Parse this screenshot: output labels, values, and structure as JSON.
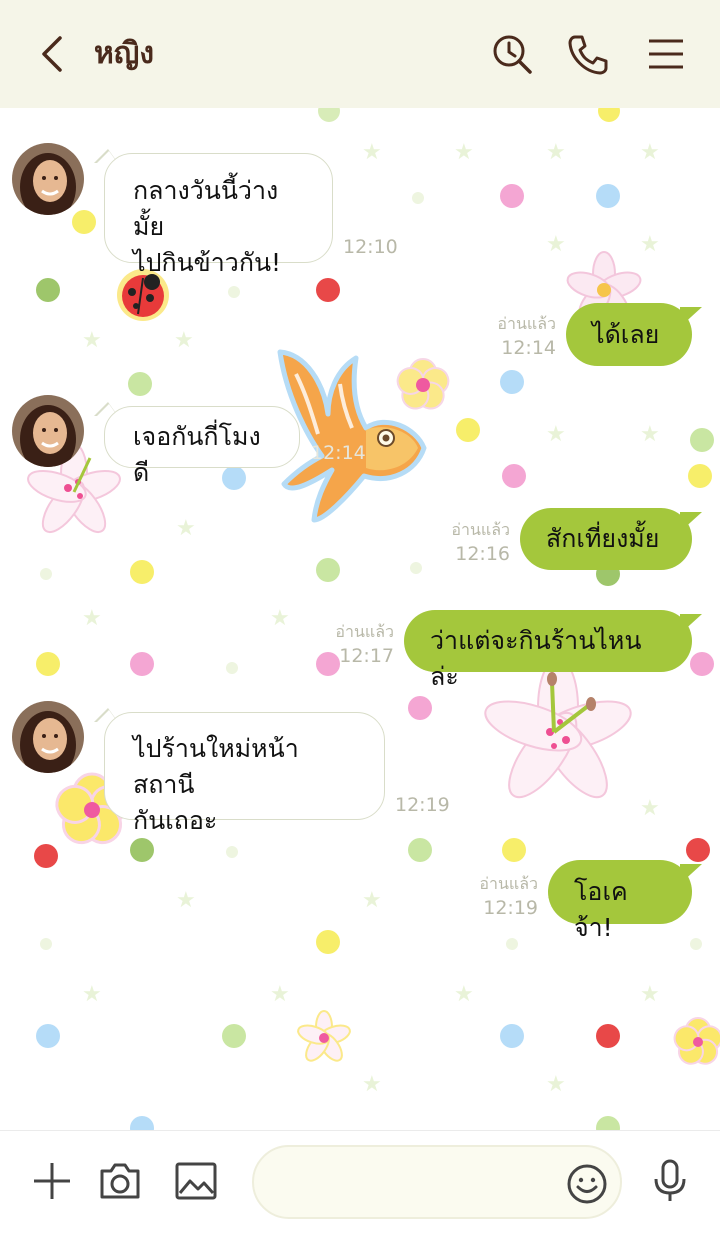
{
  "header": {
    "title": "หญิง",
    "background": "#f5f5e8",
    "text_color": "#4a2a1c"
  },
  "messages": [
    {
      "side": "in",
      "text_lines": [
        "กลางวันนี้ว่างมั้ย",
        "ไปกินข้าวกัน!"
      ],
      "time": "12:10"
    },
    {
      "side": "out",
      "text": "ได้เลย",
      "read": "อ่านแล้ว",
      "time": "12:14"
    },
    {
      "side": "in",
      "text": "เจอกันกี่โมงดี",
      "time": "12:14"
    },
    {
      "side": "out",
      "text": "สักเที่ยงมั้ย",
      "read": "อ่านแล้ว",
      "time": "12:16"
    },
    {
      "side": "out",
      "text": "ว่าแต่จะกินร้านไหนล่ะ",
      "read": "อ่านแล้ว",
      "time": "12:17"
    },
    {
      "side": "in",
      "text_lines": [
        "ไปร้านใหม่หน้าสถานี",
        "กันเถอะ"
      ],
      "time": "12:19"
    },
    {
      "side": "out",
      "text": "โอเคจ้า!",
      "read": "อ่านแล้ว",
      "time": "12:19"
    }
  ],
  "icons": {
    "back": "chevron-left-icon",
    "search": "search-clock-icon",
    "call": "phone-icon",
    "menu": "menu-icon",
    "add": "plus-icon",
    "camera": "camera-icon",
    "image": "image-icon",
    "emoji": "smiley-icon",
    "mic": "microphone-icon"
  },
  "colors": {
    "outgoing_bubble": "#a4c73c",
    "incoming_bubble": "#ffffff",
    "meta_text": "#b8b8a8"
  },
  "composer": {
    "placeholder": ""
  }
}
